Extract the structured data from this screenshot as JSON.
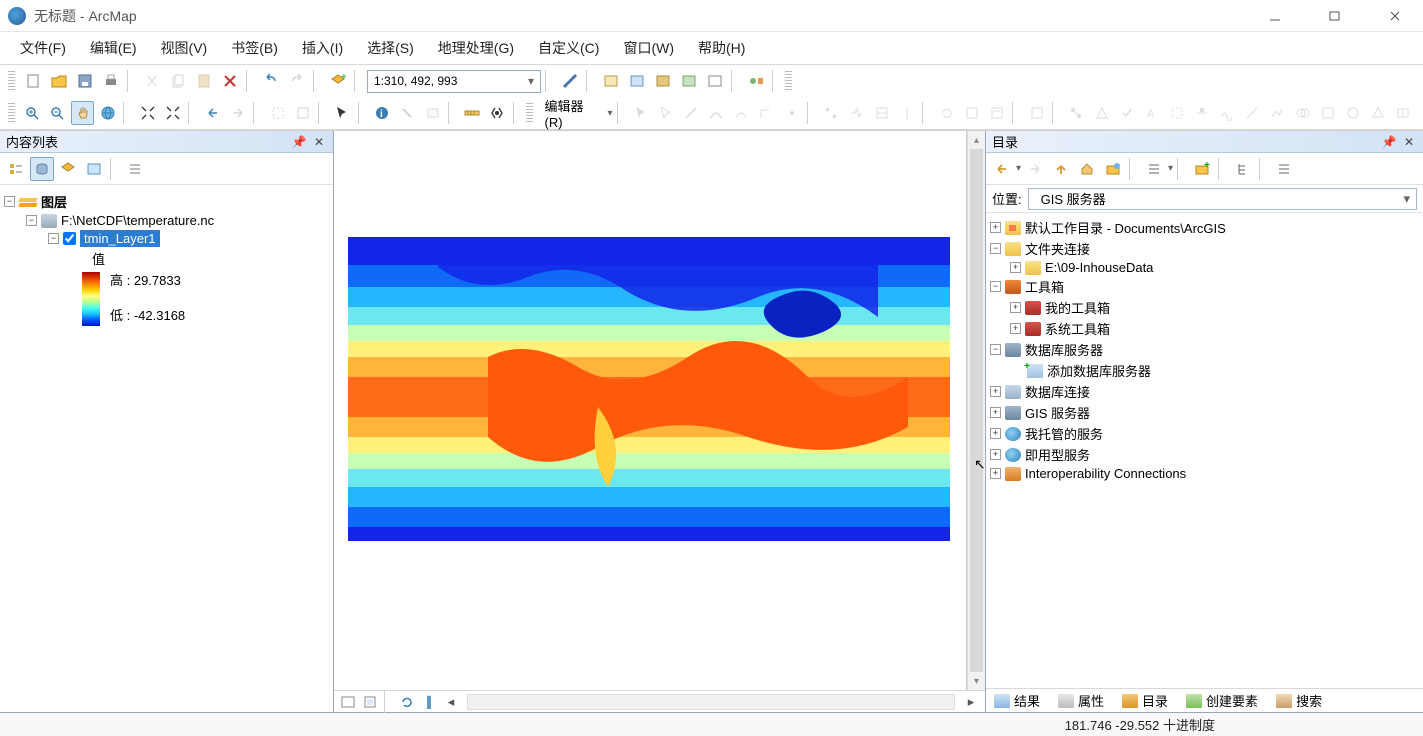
{
  "window": {
    "title": "无标题 - ArcMap"
  },
  "menu": [
    "文件(F)",
    "编辑(E)",
    "视图(V)",
    "书签(B)",
    "插入(I)",
    "选择(S)",
    "地理处理(G)",
    "自定义(C)",
    "窗口(W)",
    "帮助(H)"
  ],
  "toolbar": {
    "scale": "1:310, 492, 993",
    "editor_label": "编辑器(R)"
  },
  "toc": {
    "panel_title": "内容列表",
    "root": "图层",
    "dataset": "F:\\NetCDF\\temperature.nc",
    "layer": "tmin_Layer1",
    "value_label": "值",
    "high_label": "高 : 29.7833",
    "low_label": "低 : -42.3168"
  },
  "catalog": {
    "panel_title": "目录",
    "location_label": "位置:",
    "location_value": "GIS 服务器",
    "items": [
      {
        "expander": "+",
        "icon": "home-folder",
        "label": "默认工作目录 - Documents\\ArcGIS",
        "indent": 0
      },
      {
        "expander": "-",
        "icon": "folder",
        "label": "文件夹连接",
        "indent": 0
      },
      {
        "expander": "+",
        "icon": "folder",
        "label": "E:\\09-InhouseData",
        "indent": 1
      },
      {
        "expander": "-",
        "icon": "toolbox",
        "label": "工具箱",
        "indent": 0
      },
      {
        "expander": "+",
        "icon": "toolbox-red",
        "label": "我的工具箱",
        "indent": 1
      },
      {
        "expander": "+",
        "icon": "toolbox-red",
        "label": "系统工具箱",
        "indent": 1
      },
      {
        "expander": "-",
        "icon": "dbserver",
        "label": "数据库服务器",
        "indent": 0
      },
      {
        "expander": "",
        "icon": "addserver",
        "label": "添加数据库服务器",
        "indent": 1
      },
      {
        "expander": "+",
        "icon": "connect",
        "label": "数据库连接",
        "indent": 0
      },
      {
        "expander": "+",
        "icon": "dbserver",
        "label": "GIS 服务器",
        "indent": 0
      },
      {
        "expander": "+",
        "icon": "globe",
        "label": "我托管的服务",
        "indent": 0
      },
      {
        "expander": "+",
        "icon": "globe",
        "label": "即用型服务",
        "indent": 0
      },
      {
        "expander": "+",
        "icon": "interop",
        "label": "Interoperability Connections",
        "indent": 0
      }
    ]
  },
  "right_tabs": [
    {
      "icon": "results",
      "label": "结果"
    },
    {
      "icon": "props",
      "label": "属性"
    },
    {
      "icon": "catalog",
      "label": "目录"
    },
    {
      "icon": "create",
      "label": "创建要素"
    },
    {
      "icon": "search",
      "label": "搜索"
    }
  ],
  "status": {
    "coords": "181.746  -29.552 十进制度"
  }
}
